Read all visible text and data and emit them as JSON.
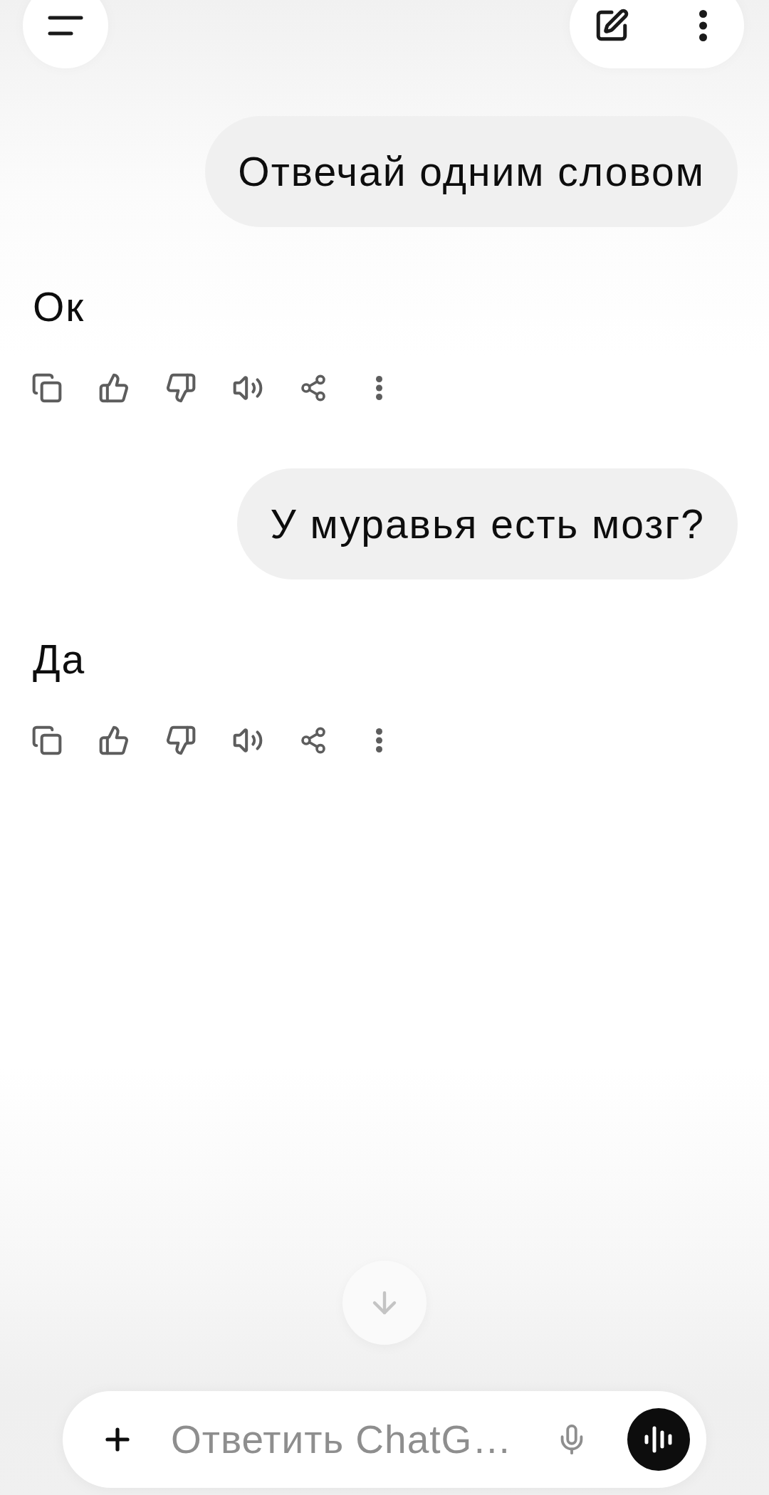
{
  "messages": [
    {
      "kind": "user",
      "text": "Отвечай одним словом"
    },
    {
      "kind": "assistant",
      "text": "Ок"
    },
    {
      "kind": "user",
      "text": "У муравья есть мозг?"
    },
    {
      "kind": "assistant",
      "text": "Да"
    }
  ],
  "composer": {
    "placeholder": "Ответить ChatG…"
  }
}
